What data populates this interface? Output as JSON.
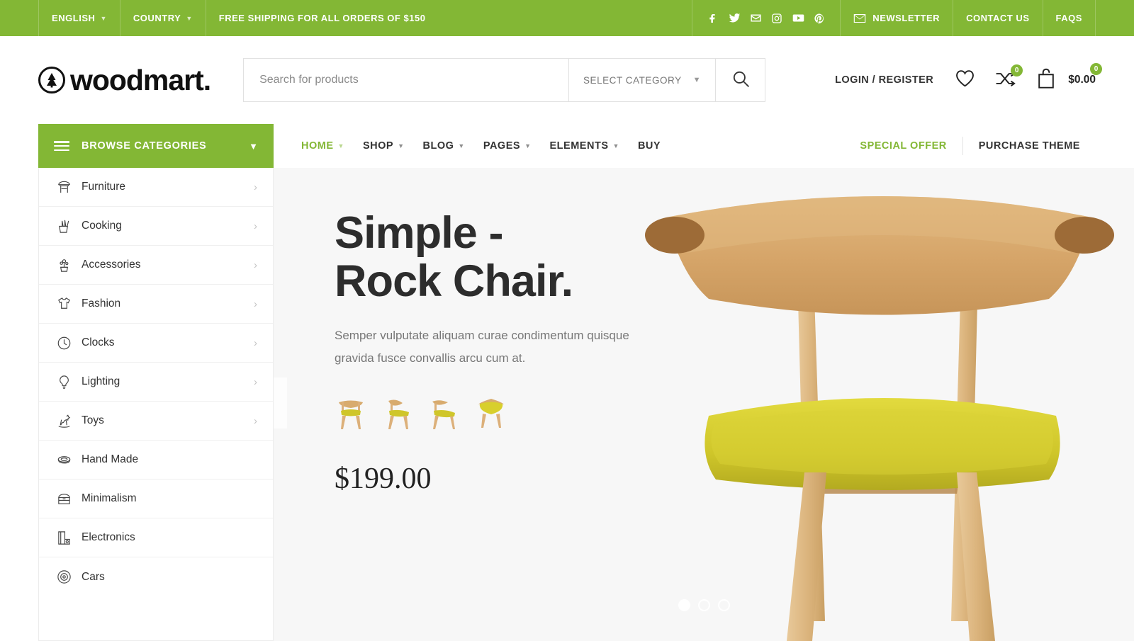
{
  "topbar": {
    "language": "ENGLISH",
    "country": "COUNTRY",
    "promo": "FREE SHIPPING FOR ALL ORDERS OF $150",
    "social": [
      "facebook-icon",
      "twitter-icon",
      "email-icon",
      "instagram-icon",
      "youtube-icon",
      "pinterest-icon"
    ],
    "newsletter": "NEWSLETTER",
    "contact": "CONTACT US",
    "faqs": "FAQS"
  },
  "header": {
    "logo_text": "woodmart.",
    "search_placeholder": "Search for products",
    "search_value": "",
    "select_category": "SELECT CATEGORY",
    "login": "LOGIN / REGISTER",
    "compare_count": "0",
    "cart_count": "0",
    "cart_total": "$0.00"
  },
  "nav": {
    "browse_label": "BROWSE CATEGORIES",
    "items": [
      {
        "label": "HOME",
        "has_caret": true,
        "active": true
      },
      {
        "label": "SHOP",
        "has_caret": true,
        "active": false
      },
      {
        "label": "BLOG",
        "has_caret": true,
        "active": false
      },
      {
        "label": "PAGES",
        "has_caret": true,
        "active": false
      },
      {
        "label": "ELEMENTS",
        "has_caret": true,
        "active": false
      },
      {
        "label": "BUY",
        "has_caret": false,
        "active": false
      }
    ],
    "special_offer": "SPECIAL OFFER",
    "purchase_theme": "PURCHASE THEME"
  },
  "categories": [
    {
      "label": "Furniture",
      "icon": "stool-icon",
      "arrow": true
    },
    {
      "label": "Cooking",
      "icon": "knife-block-icon",
      "arrow": true
    },
    {
      "label": "Accessories",
      "icon": "potted-plant-icon",
      "arrow": true
    },
    {
      "label": "Fashion",
      "icon": "tshirt-icon",
      "arrow": true
    },
    {
      "label": "Clocks",
      "icon": "clock-icon",
      "arrow": true
    },
    {
      "label": "Lighting",
      "icon": "lightbulb-icon",
      "arrow": true
    },
    {
      "label": "Toys",
      "icon": "rocking-horse-icon",
      "arrow": true
    },
    {
      "label": "Hand Made",
      "icon": "bowl-icon",
      "arrow": false
    },
    {
      "label": "Minimalism",
      "icon": "cabinet-icon",
      "arrow": false
    },
    {
      "label": "Electronics",
      "icon": "appliance-icon",
      "arrow": false
    },
    {
      "label": "Cars",
      "icon": "wheel-icon",
      "arrow": false
    }
  ],
  "hero": {
    "title_line1": "Simple -",
    "title_line2": "Rock Chair.",
    "subtitle": "Semper vulputate aliquam curae condimentum quisque gravida fusce convallis arcu cum at.",
    "price": "$199.00",
    "thumbnails": [
      "chair-front-thumb",
      "chair-angle-thumb",
      "chair-side-thumb",
      "chair-top-thumb"
    ],
    "slide_count": 3,
    "active_slide": 1
  },
  "colors": {
    "brand_green": "#83b735",
    "hero_bg": "#f7f7f7",
    "text_dark": "#2d2d2d",
    "chair_seat": "#d4cc2a",
    "chair_wood": "#d9ab70"
  }
}
